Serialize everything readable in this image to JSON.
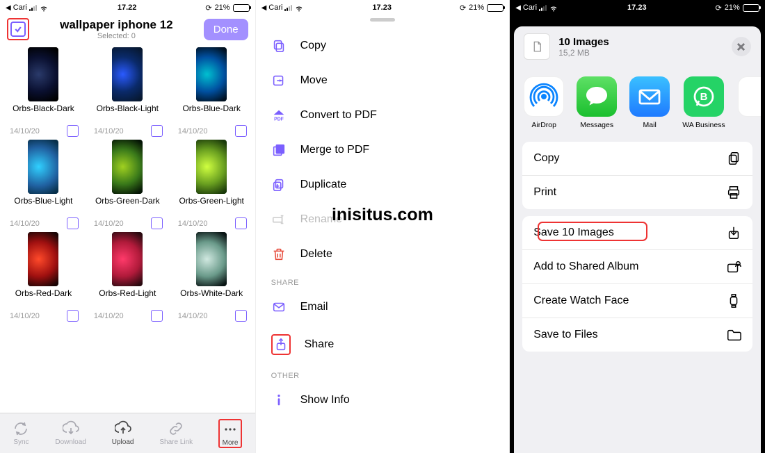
{
  "status": {
    "back_label": "Cari",
    "time1": "17.22",
    "time2": "17.23",
    "time3": "17.23",
    "battery": "21%"
  },
  "panel1": {
    "title": "wallpaper iphone 12",
    "subtitle": "Selected: 0",
    "done": "Done",
    "items": [
      {
        "name": "Orbs-Black-Dark",
        "date": "14/10/20",
        "cls": "orb-black-dark"
      },
      {
        "name": "Orbs-Black-Light",
        "date": "14/10/20",
        "cls": "orb-black-light"
      },
      {
        "name": "Orbs-Blue-Dark",
        "date": "14/10/20",
        "cls": "orb-blue-dark"
      },
      {
        "name": "Orbs-Blue-Light",
        "date": "14/10/20",
        "cls": "orb-blue-light"
      },
      {
        "name": "Orbs-Green-Dark",
        "date": "14/10/20",
        "cls": "orb-green-dark"
      },
      {
        "name": "Orbs-Green-Light",
        "date": "14/10/20",
        "cls": "orb-green-light"
      },
      {
        "name": "Orbs-Red-Dark",
        "date": "14/10/20",
        "cls": "orb-red-dark"
      },
      {
        "name": "Orbs-Red-Light",
        "date": "14/10/20",
        "cls": "orb-red-light"
      },
      {
        "name": "Orbs-White-Dark",
        "date": "14/10/20",
        "cls": "orb-white-dark"
      }
    ],
    "tabs": {
      "sync": "Sync",
      "download": "Download",
      "upload": "Upload",
      "sharelink": "Share Link",
      "more": "More"
    }
  },
  "panel2": {
    "copy": "Copy",
    "move": "Move",
    "pdf": "Convert to PDF",
    "merge": "Merge to PDF",
    "duplicate": "Duplicate",
    "rename": "Rename",
    "delete": "Delete",
    "share_section": "SHARE",
    "email": "Email",
    "share": "Share",
    "other_section": "OTHER",
    "info": "Show Info",
    "watermark": "inisitus.com"
  },
  "panel3": {
    "title": "10 Images",
    "size": "15,2 MB",
    "apps": {
      "airdrop": "AirDrop",
      "messages": "Messages",
      "mail": "Mail",
      "wa": "WA Business"
    },
    "actions": {
      "copy": "Copy",
      "print": "Print",
      "save": "Save 10 Images",
      "album": "Add to Shared Album",
      "watch": "Create Watch Face",
      "files": "Save to Files"
    }
  }
}
